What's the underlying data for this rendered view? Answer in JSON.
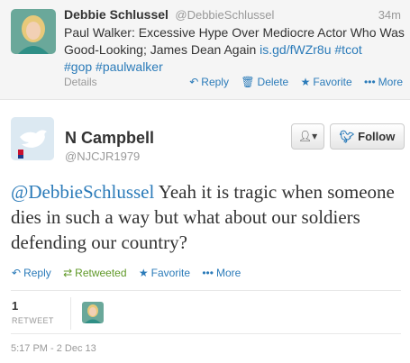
{
  "original_tweet": {
    "author_name": "Debbie Schlussel",
    "author_handle": "@DebbieSchlussel",
    "time": "34m",
    "text_plain": "Paul Walker: Excessive Hype Over Mediocre Actor Who Was Good-Looking; James Dean Again ",
    "link": "is.gd/fWZr8u",
    "hashtag1": "#tcot",
    "hashtag2": "#gop",
    "hashtag3": "#paulwalker",
    "details_label": "Details",
    "actions": {
      "reply": "Reply",
      "delete": "Delete",
      "favorite": "Favorite",
      "more": "More"
    }
  },
  "main_tweet": {
    "author_name": "N Campbell",
    "author_handle": "@NJCJR1979",
    "mention": "@DebbieSchlussel",
    "text": " Yeah it is tragic when someone dies in such a way but what about our soldiers defending our country?",
    "follow_label": "Follow",
    "actions": {
      "reply": "Reply",
      "retweeted": "Retweeted",
      "favorite": "Favorite",
      "more": "More"
    },
    "retweet_count": "1",
    "retweet_label": "RETWEET",
    "timestamp": "5:17 PM - 2 Dec 13"
  },
  "icons": {
    "reply": "reply-icon",
    "delete": "trash-icon",
    "favorite": "star-icon",
    "more": "ellipsis-icon",
    "retweeted": "retweet-icon",
    "user_menu": "user-dropdown-icon",
    "follow": "twitter-bird-icon"
  },
  "colors": {
    "link": "#2b7bb9",
    "retweeted": "#609928",
    "muted": "#999999",
    "text": "#333333"
  }
}
